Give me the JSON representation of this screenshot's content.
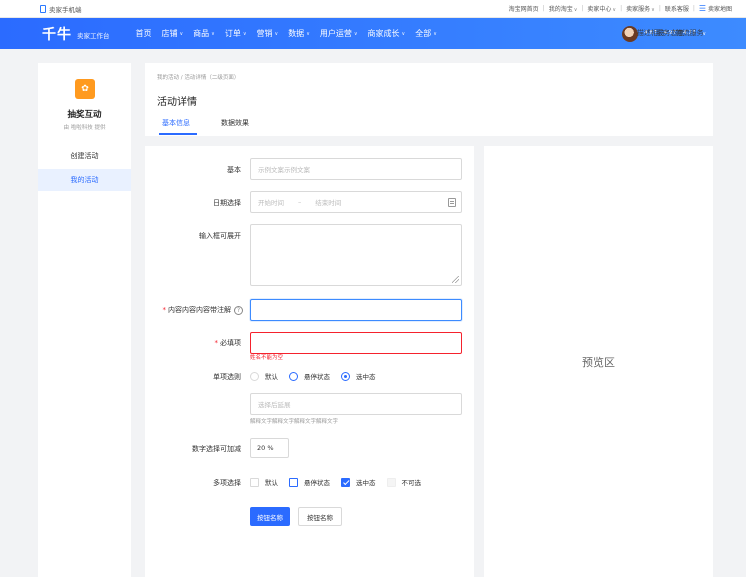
{
  "topbar": {
    "mobile_label": "卖家手机端",
    "links": [
      "淘宝网首页",
      "我的淘宝",
      "卖家中心",
      "卖家服务",
      "联系客服",
      "卖家地图"
    ]
  },
  "navbar": {
    "logo": "千牛",
    "logo_sub": "卖家工作台",
    "items": [
      "首页",
      "店铺",
      "商品",
      "订单",
      "营销",
      "数据",
      "用户运营",
      "商家成长",
      "全部"
    ],
    "scores": [
      {
        "label": "描述相符",
        "value": "4.8↑"
      },
      {
        "label": "服务态度",
        "value": "4.9↑"
      },
      {
        "label": "物流服务",
        "value": "4.7↑"
      }
    ]
  },
  "sidebar": {
    "app_title": "抽奖互动",
    "app_provider": "由 啦啦科技 提供",
    "items": [
      {
        "label": "创建活动"
      },
      {
        "label": "我的活动"
      }
    ]
  },
  "header": {
    "breadcrumb": "我的活动 / 活动详情（二级页面）",
    "title": "活动详情",
    "tabs": [
      "基本信息",
      "数据效果"
    ]
  },
  "form": {
    "basic_label": "基本",
    "basic_placeholder": "示例文案示例文案",
    "date_label": "日期选择",
    "date_start": "开始时间",
    "date_sep": "–",
    "date_end": "结束时间",
    "textarea_label": "输入框可展开",
    "note_label": "内容内容内容带注解",
    "required_label": "必填项",
    "required_error": "姓名不能为空",
    "radio_label": "单项选则",
    "radio_options": [
      "默认",
      "悬停状态",
      "选中态"
    ],
    "select_placeholder": "选择后延展",
    "hint": "解释文字解释文字解释文字解释文字",
    "number_label": "数字选择可加减",
    "number_value": "20 %",
    "checkbox_label": "多项选择",
    "checkbox_options": [
      "默认",
      "悬停状态",
      "选中态",
      "不可选"
    ],
    "primary_button": "按钮名称",
    "secondary_button": "按钮名称"
  },
  "preview": {
    "label": "预览区"
  },
  "colors": {
    "primary": "#2b6bff",
    "error": "#f5222d",
    "accent_icon": "#ff9a1f"
  }
}
